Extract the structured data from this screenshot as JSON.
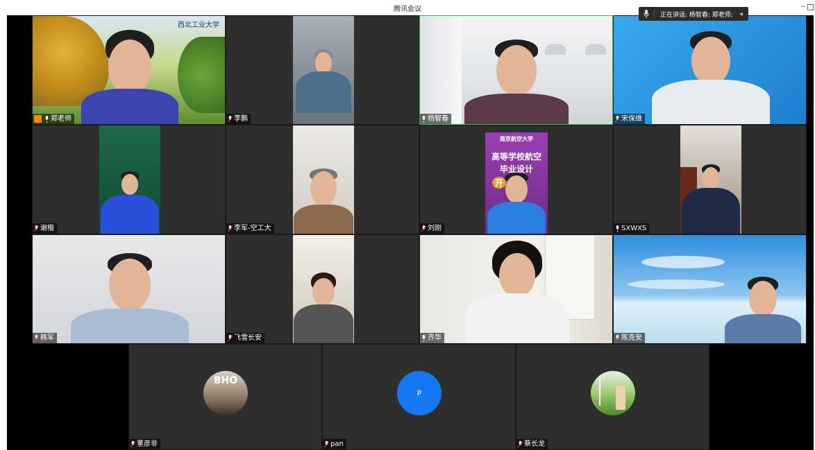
{
  "window": {
    "title": "腾讯会议",
    "minimize": "–"
  },
  "speaking_bar": {
    "text": "正在讲话: 杨智春; 郑老师;"
  },
  "participants": [
    {
      "name": "郑老师",
      "host": true
    },
    {
      "name": "李鹏"
    },
    {
      "name": "杨智春"
    },
    {
      "name": "宋保维"
    },
    {
      "name": "谢楷"
    },
    {
      "name": "李军-空工大"
    },
    {
      "name": "刘刚"
    },
    {
      "name": "SXWXS"
    },
    {
      "name": "韩军"
    },
    {
      "name": "飞雪长安"
    },
    {
      "name": "齐华"
    },
    {
      "name": "陈克安"
    },
    {
      "name": "董彦非"
    },
    {
      "name": "pan",
      "initial": "P"
    },
    {
      "name": "蔡长龙"
    }
  ],
  "tile1_logo": "西北工业大学",
  "tile7_banner": {
    "line1": "高等学校航空",
    "line2": "毕业设计",
    "line3": "开",
    "header": "南京航空大学"
  },
  "tile13_photo_text": "BHO",
  "colors": {
    "stage_bg": "#000000",
    "tile_bg": "#2e2e2e",
    "avatar_blue": "#1677f3",
    "host_badge": "#ff8a00"
  }
}
